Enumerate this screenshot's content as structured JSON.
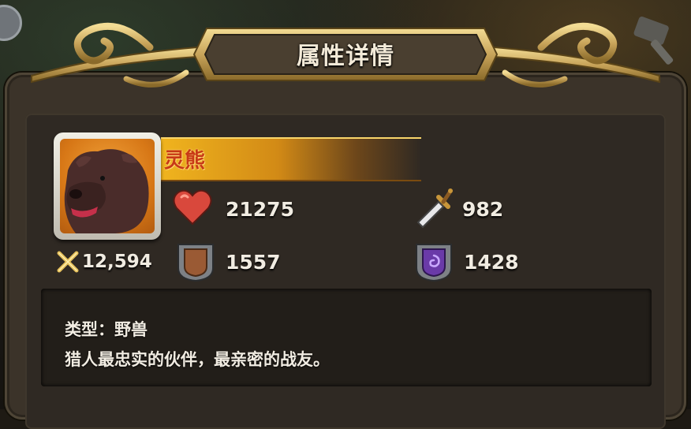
{
  "window": {
    "title": "属性详情"
  },
  "unit": {
    "name": "灵熊",
    "portrait_icon": "bear-portrait-icon",
    "power": "12,594"
  },
  "stats": {
    "health": {
      "icon": "heart-icon",
      "value": "21275"
    },
    "attack": {
      "icon": "sword-icon",
      "value": "982"
    },
    "physical_defense": {
      "icon": "shield-icon",
      "value": "1557"
    },
    "magic_defense": {
      "icon": "magic-shield-icon",
      "value": "1428"
    }
  },
  "description": {
    "type_line": "类型：野兽",
    "flavor_line": "猎人最忠实的伙伴，最亲密的战友。"
  },
  "colors": {
    "title_text": "#f3ead8",
    "name_text": "#c83a16",
    "banner_gold": "#f0b41e",
    "panel_bg": "#3b3329",
    "frame_gold": "#c8a85c"
  }
}
